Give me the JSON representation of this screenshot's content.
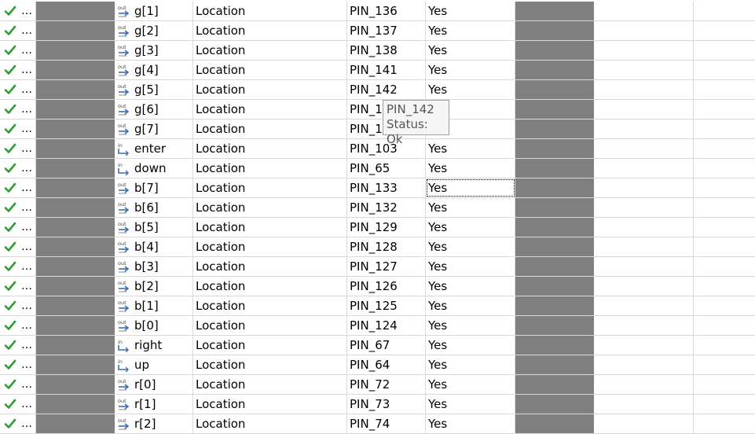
{
  "rows": [
    {
      "status": "…",
      "dir": "out",
      "name": "g[1]",
      "type": "Location",
      "value": "PIN_136",
      "enabled": "Yes"
    },
    {
      "status": "…",
      "dir": "out",
      "name": "g[2]",
      "type": "Location",
      "value": "PIN_137",
      "enabled": "Yes"
    },
    {
      "status": "…",
      "dir": "out",
      "name": "g[3]",
      "type": "Location",
      "value": "PIN_138",
      "enabled": "Yes"
    },
    {
      "status": "…",
      "dir": "out",
      "name": "g[4]",
      "type": "Location",
      "value": "PIN_141",
      "enabled": "Yes"
    },
    {
      "status": "…",
      "dir": "out",
      "name": "g[5]",
      "type": "Location",
      "value": "PIN_142",
      "enabled": "Yes"
    },
    {
      "status": "…",
      "dir": "out",
      "name": "g[6]",
      "type": "Location",
      "value": "PIN_1",
      "enabled": ""
    },
    {
      "status": "…",
      "dir": "out",
      "name": "g[7]",
      "type": "Location",
      "value": "PIN_1",
      "enabled": ""
    },
    {
      "status": "…",
      "dir": "in",
      "name": "enter",
      "type": "Location",
      "value": "PIN_103",
      "enabled": "Yes"
    },
    {
      "status": "…",
      "dir": "in",
      "name": "down",
      "type": "Location",
      "value": "PIN_65",
      "enabled": "Yes"
    },
    {
      "status": "…",
      "dir": "out",
      "name": "b[7]",
      "type": "Location",
      "value": "PIN_133",
      "enabled": "Yes"
    },
    {
      "status": "…",
      "dir": "out",
      "name": "b[6]",
      "type": "Location",
      "value": "PIN_132",
      "enabled": "Yes"
    },
    {
      "status": "…",
      "dir": "out",
      "name": "b[5]",
      "type": "Location",
      "value": "PIN_129",
      "enabled": "Yes"
    },
    {
      "status": "…",
      "dir": "out",
      "name": "b[4]",
      "type": "Location",
      "value": "PIN_128",
      "enabled": "Yes"
    },
    {
      "status": "…",
      "dir": "out",
      "name": "b[3]",
      "type": "Location",
      "value": "PIN_127",
      "enabled": "Yes"
    },
    {
      "status": "…",
      "dir": "out",
      "name": "b[2]",
      "type": "Location",
      "value": "PIN_126",
      "enabled": "Yes"
    },
    {
      "status": "…",
      "dir": "out",
      "name": "b[1]",
      "type": "Location",
      "value": "PIN_125",
      "enabled": "Yes"
    },
    {
      "status": "…",
      "dir": "out",
      "name": "b[0]",
      "type": "Location",
      "value": "PIN_124",
      "enabled": "Yes"
    },
    {
      "status": "…",
      "dir": "in",
      "name": "right",
      "type": "Location",
      "value": "PIN_67",
      "enabled": "Yes"
    },
    {
      "status": "…",
      "dir": "in",
      "name": "up",
      "type": "Location",
      "value": "PIN_64",
      "enabled": "Yes"
    },
    {
      "status": "…",
      "dir": "out",
      "name": "r[0]",
      "type": "Location",
      "value": "PIN_72",
      "enabled": "Yes"
    },
    {
      "status": "…",
      "dir": "out",
      "name": "r[1]",
      "type": "Location",
      "value": "PIN_73",
      "enabled": "Yes"
    },
    {
      "status": "…",
      "dir": "out",
      "name": "r[2]",
      "type": "Location",
      "value": "PIN_74",
      "enabled": "Yes"
    }
  ],
  "tooltip": {
    "line1": "PIN_142",
    "line2": "Status: Ok"
  },
  "colors": {
    "check": "#2e9e2e",
    "redacted": "#808080",
    "pin_icon": "#3a6fb0"
  },
  "focused_cell": "b[7] enabled"
}
